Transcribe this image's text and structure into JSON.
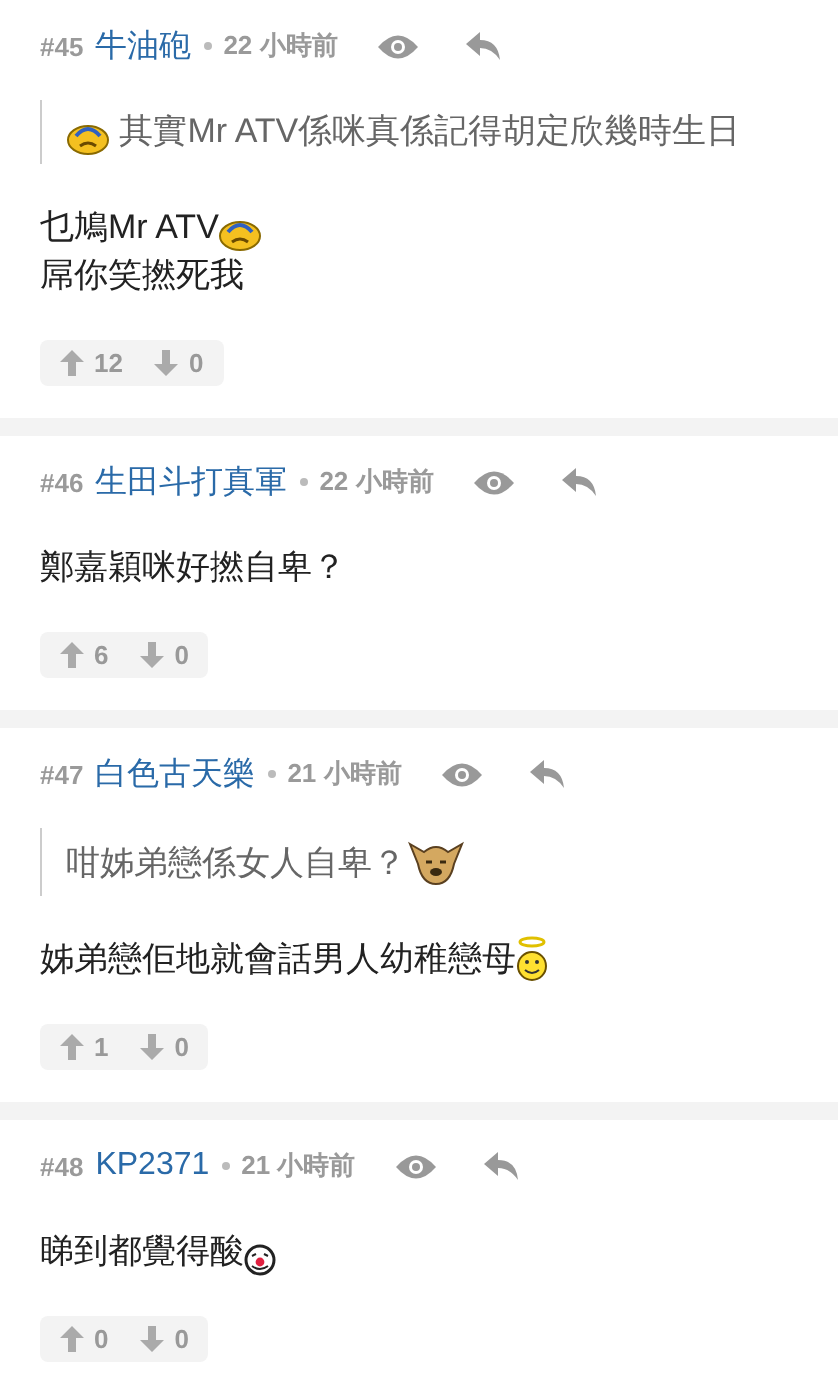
{
  "posts": [
    {
      "number": "#45",
      "author": "牛油砲",
      "time": "22 小時前",
      "blocks": [
        {
          "kind": "quote",
          "lines": [
            [
              {
                "kind": "sweat-face"
              },
              {
                "kind": "text",
                "text": " 其實Mr ATV係咪真係記得胡定欣幾時生日"
              }
            ]
          ]
        },
        {
          "kind": "text",
          "lines": [
            [
              {
                "kind": "text",
                "text": "乜鳩Mr ATV"
              },
              {
                "kind": "sweat-face"
              }
            ],
            [
              {
                "kind": "text",
                "text": "屌你笑撚死我"
              }
            ]
          ]
        }
      ],
      "upvotes": "12",
      "downvotes": "0"
    },
    {
      "number": "#46",
      "author": "生田斗打真軍",
      "time": "22 小時前",
      "blocks": [
        {
          "kind": "text",
          "lines": [
            [
              {
                "kind": "text",
                "text": "鄭嘉穎咪好撚自卑？"
              }
            ]
          ]
        }
      ],
      "upvotes": "6",
      "downvotes": "0"
    },
    {
      "number": "#47",
      "author": "白色古天樂",
      "time": "21 小時前",
      "blocks": [
        {
          "kind": "quote",
          "lines": [
            [
              {
                "kind": "text",
                "text": "咁姊弟戀係女人自卑？"
              },
              {
                "kind": "dog-face"
              }
            ]
          ]
        },
        {
          "kind": "text",
          "lines": [
            [
              {
                "kind": "text",
                "text": "姊弟戀佢地就會話男人幼稚戀母"
              },
              {
                "kind": "angel-face"
              }
            ]
          ]
        }
      ],
      "upvotes": "1",
      "downvotes": "0"
    },
    {
      "number": "#48",
      "author": "KP2371",
      "time": "21 小時前",
      "blocks": [
        {
          "kind": "text",
          "lines": [
            [
              {
                "kind": "text",
                "text": "睇到都覺得酸"
              },
              {
                "kind": "clown-face"
              }
            ]
          ]
        }
      ],
      "upvotes": "0",
      "downvotes": "0"
    }
  ]
}
